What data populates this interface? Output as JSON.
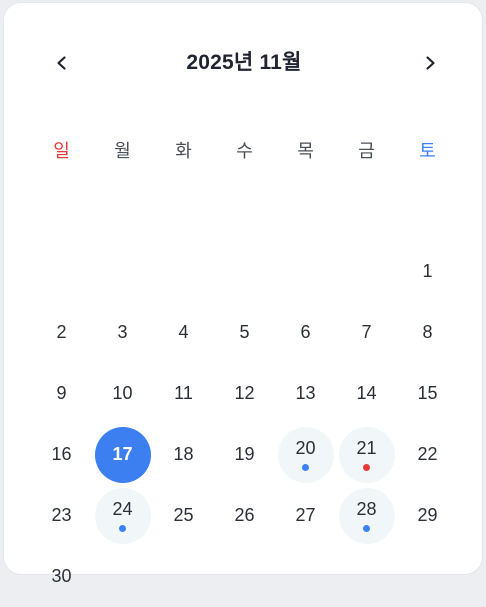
{
  "calendar": {
    "title": "2025년 11월",
    "weekdays": [
      "일",
      "월",
      "화",
      "수",
      "목",
      "금",
      "토"
    ],
    "leading_blank_days": 6,
    "today": 17,
    "colors": {
      "today_bg": "#3b7ff0",
      "event_bg": "#f1f6f8",
      "sunday": "#e83a3a",
      "saturday": "#3b82f6",
      "dot_blue": "#3b82f6",
      "dot_red": "#e83a3a"
    },
    "days": [
      {
        "day": "1"
      },
      {
        "day": "2"
      },
      {
        "day": "3"
      },
      {
        "day": "4"
      },
      {
        "day": "5"
      },
      {
        "day": "6"
      },
      {
        "day": "7"
      },
      {
        "day": "8"
      },
      {
        "day": "9"
      },
      {
        "day": "10"
      },
      {
        "day": "11"
      },
      {
        "day": "12"
      },
      {
        "day": "13"
      },
      {
        "day": "14"
      },
      {
        "day": "15"
      },
      {
        "day": "16"
      },
      {
        "day": "17",
        "today": true
      },
      {
        "day": "18"
      },
      {
        "day": "19"
      },
      {
        "day": "20",
        "event": "blue"
      },
      {
        "day": "21",
        "event": "red"
      },
      {
        "day": "22"
      },
      {
        "day": "23"
      },
      {
        "day": "24",
        "event": "blue"
      },
      {
        "day": "25"
      },
      {
        "day": "26"
      },
      {
        "day": "27"
      },
      {
        "day": "28",
        "event": "blue"
      },
      {
        "day": "29"
      },
      {
        "day": "30"
      }
    ]
  },
  "icons": {
    "prev": "chevron-left-icon",
    "next": "chevron-right-icon"
  }
}
